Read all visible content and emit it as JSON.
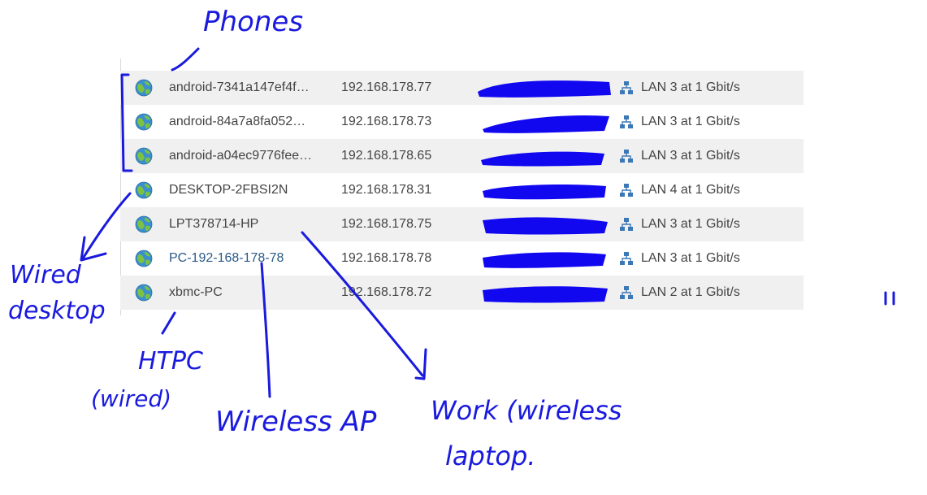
{
  "devices": [
    {
      "name": "android-7341a147ef4f…",
      "ip": "192.168.178.77",
      "connection": "LAN 3 at 1 Gbit/s"
    },
    {
      "name": "android-84a7a8fa052…",
      "ip": "192.168.178.73",
      "connection": "LAN 3 at 1 Gbit/s"
    },
    {
      "name": "android-a04ec9776fee…",
      "ip": "192.168.178.65",
      "connection": "LAN 3 at 1 Gbit/s"
    },
    {
      "name": "DESKTOP-2FBSI2N",
      "ip": "192.168.178.31",
      "connection": "LAN 4 at 1 Gbit/s"
    },
    {
      "name": "LPT378714-HP",
      "ip": "192.168.178.75",
      "connection": "LAN 3 at 1 Gbit/s"
    },
    {
      "name": "PC-192-168-178-78",
      "ip": "192.168.178.78",
      "connection": "LAN 3 at 1 Gbit/s"
    },
    {
      "name": "xbmc-PC",
      "ip": "192.168.178.72",
      "connection": "LAN 2 at 1 Gbit/s"
    }
  ],
  "annotations": {
    "phones": "Phones",
    "wired_desktop_1": "Wired",
    "wired_desktop_2": "desktop",
    "htpc_1": "HTPC",
    "htpc_2": "(wired)",
    "wireless_ap": "Wireless AP",
    "work_laptop_1": "Work (wireless",
    "work_laptop_2": "laptop."
  },
  "icons": {
    "status": "globe-icon",
    "network": "network-icon"
  },
  "colors": {
    "alt_row": "#f0f0f0",
    "link": "#2a5a86",
    "redaction": "#1208f0",
    "annotation_ink": "#1a1adf"
  }
}
